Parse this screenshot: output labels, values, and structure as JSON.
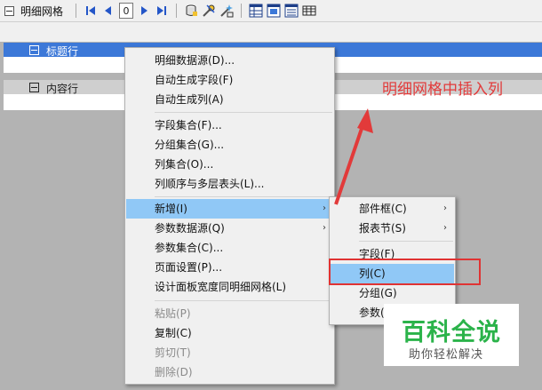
{
  "toolbar": {
    "title": "明细网格",
    "page_value": "0",
    "icons": [
      "first-page-icon",
      "prev-page-icon",
      "next-page-icon",
      "last-page-icon",
      "db-icon",
      "tools-icon",
      "wand-icon",
      "grid-prop-icon",
      "grid-layout-icon",
      "grid-group-icon",
      "grid-table-icon"
    ]
  },
  "bands": {
    "title_band": "标题行",
    "content_band": "内容行"
  },
  "context_menu": {
    "items": [
      {
        "label": "明细数据源(D)...",
        "enabled": true
      },
      {
        "label": "自动生成字段(F)",
        "enabled": true
      },
      {
        "label": "自动生成列(A)",
        "enabled": true
      },
      {
        "label": "字段集合(F)...",
        "enabled": true
      },
      {
        "label": "分组集合(G)...",
        "enabled": true
      },
      {
        "label": "列集合(O)...",
        "enabled": true
      },
      {
        "label": "列顺序与多层表头(L)...",
        "enabled": true
      },
      {
        "label": "新增(I)",
        "enabled": true,
        "submenu": true,
        "highlighted": true
      },
      {
        "label": "参数数据源(Q)",
        "enabled": true,
        "submenu": true
      },
      {
        "label": "参数集合(C)...",
        "enabled": true
      },
      {
        "label": "页面设置(P)...",
        "enabled": true
      },
      {
        "label": "设计面板宽度同明细网格(L)",
        "enabled": true
      },
      {
        "label": "粘贴(P)",
        "enabled": false
      },
      {
        "label": "复制(C)",
        "enabled": true
      },
      {
        "label": "剪切(T)",
        "enabled": false
      },
      {
        "label": "删除(D)",
        "enabled": false
      }
    ],
    "submenu_arrow": "›"
  },
  "sub_menu": {
    "items": [
      {
        "label": "部件框(C)",
        "submenu": true
      },
      {
        "label": "报表节(S)",
        "submenu": true
      },
      {
        "label": "字段(F)"
      },
      {
        "label": "列(C)",
        "highlighted": true
      },
      {
        "label": "分组(G)"
      },
      {
        "label": "参数("
      }
    ]
  },
  "annotation": "明细网格中插入列",
  "watermark": {
    "big": "百科全说",
    "small": "助你轻松解决"
  },
  "colors": {
    "title_band": "#3c78d8",
    "menu_highlight": "#90c8f6",
    "annotation": "#e23a3a",
    "watermark_green": "#2bb34a"
  }
}
